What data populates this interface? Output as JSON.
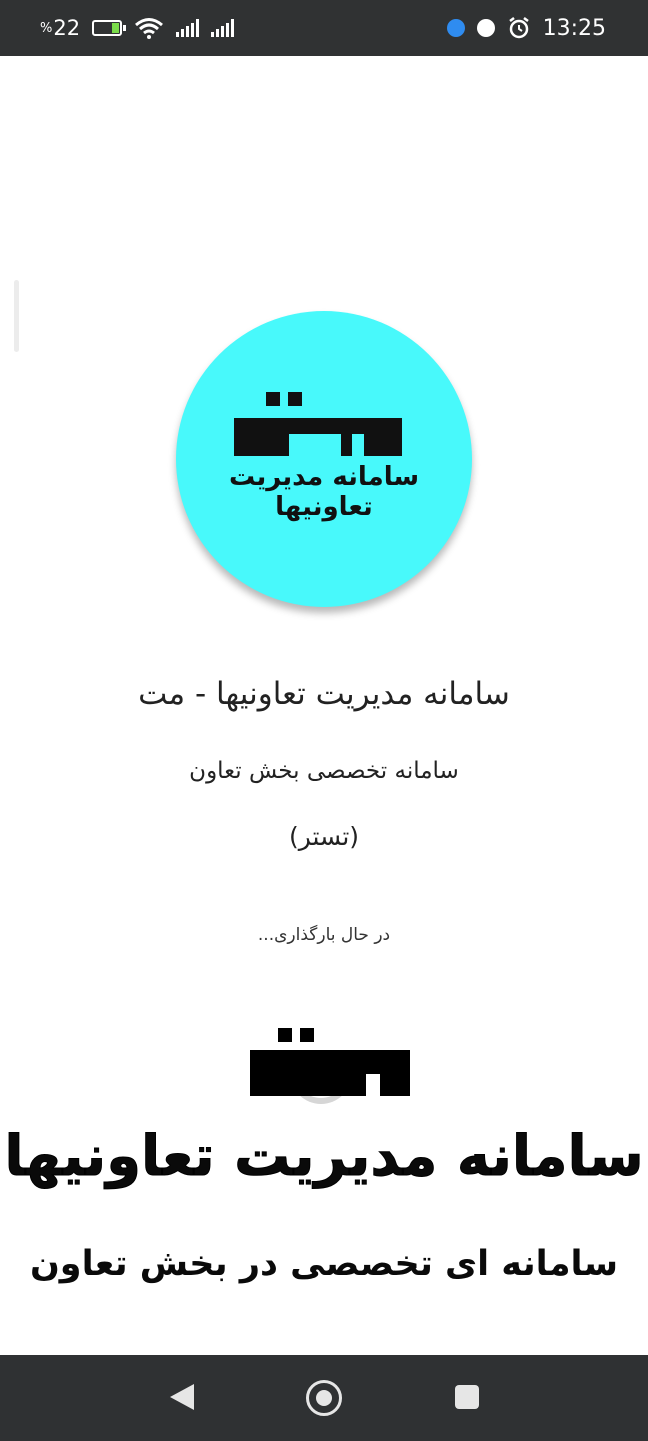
{
  "status_bar": {
    "battery_percent": "22",
    "percent_sign": "%",
    "battery_level": 0.22,
    "time": "13:25",
    "icons": [
      "battery-charging-icon",
      "wifi-icon",
      "signal-icon",
      "signal-icon",
      "app-notification-icon",
      "app-notification-icon",
      "alarm-icon"
    ]
  },
  "splash": {
    "logo_text": "سامانه مدیریت تعاونیها",
    "title": "سامانه مدیریت تعاونیها - مت",
    "subtitle": "سامانه تخصصی بخش تعاون",
    "environment": "(تستر)",
    "loading": "در حال بارگذاری..."
  },
  "brand": {
    "title": "سامانه مدیریت تعاونیها",
    "subtitle": "سامانه ای تخصصی در بخش تعاون"
  },
  "colors": {
    "status_bar_bg": "#303233",
    "logo_bg": "#48f9fb",
    "nav_bar_bg": "#2f3133",
    "battery_fill": "#7bdc4b"
  },
  "nav_bar": {
    "icons": [
      "back-icon",
      "home-icon",
      "recent-apps-icon"
    ]
  }
}
